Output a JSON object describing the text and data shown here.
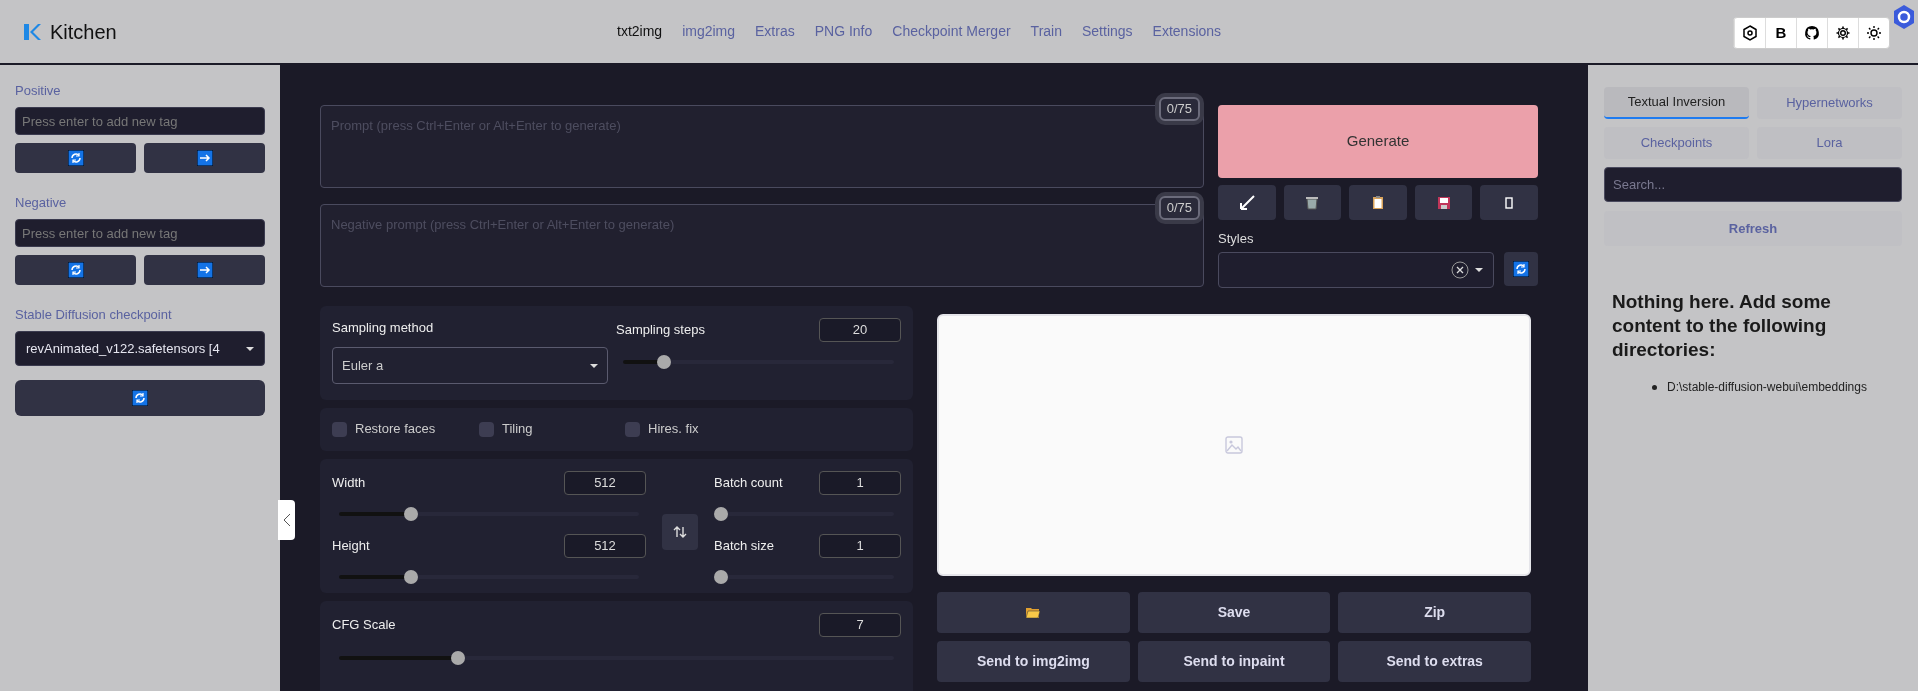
{
  "header": {
    "logo": "Kitchen",
    "nav": [
      {
        "label": "txt2img",
        "selected": true
      },
      {
        "label": "img2img",
        "selected": false
      },
      {
        "label": "Extras",
        "selected": false
      },
      {
        "label": "PNG Info",
        "selected": false
      },
      {
        "label": "Checkpoint Merger",
        "selected": false
      },
      {
        "label": "Train",
        "selected": false
      },
      {
        "label": "Settings",
        "selected": false
      },
      {
        "label": "Extensions",
        "selected": false
      }
    ],
    "buttons": [
      {
        "kind": "hex"
      },
      {
        "kind": "text",
        "label": "B"
      },
      {
        "kind": "github"
      },
      {
        "kind": "gear"
      },
      {
        "kind": "sun"
      }
    ]
  },
  "sidebar": {
    "sections": [
      {
        "label": "Positive",
        "placeholder": "Press enter to add new tag"
      },
      {
        "label": "Negative",
        "placeholder": "Press enter to add new tag"
      }
    ],
    "checkpoint": {
      "label": "Stable Diffusion checkpoint",
      "value": "revAnimated_v122.safetensors [4"
    }
  },
  "prompts": [
    {
      "placeholder": "Prompt (press Ctrl+Enter or Alt+Enter to generate)",
      "counter": "0/75"
    },
    {
      "placeholder": "Negative prompt (press Ctrl+Enter or Alt+Enter to generate)",
      "counter": "0/75"
    }
  ],
  "generate": {
    "label": "Generate",
    "tools": [
      {
        "kind": "check"
      },
      {
        "kind": "trash"
      },
      {
        "kind": "clipboard"
      },
      {
        "kind": "disk"
      },
      {
        "kind": "square"
      }
    ],
    "styles_label": "Styles"
  },
  "sampling": {
    "method_label": "Sampling method",
    "method": "Euler a",
    "steps": {
      "label": "Sampling steps",
      "value": "20",
      "level": 0.15
    }
  },
  "options": [
    {
      "label": "Restore faces",
      "checked": false
    },
    {
      "label": "Tiling",
      "checked": false
    },
    {
      "label": "Hires. fix",
      "checked": false
    }
  ],
  "size": [
    {
      "label": "Width",
      "value": "512",
      "level": 0.24
    },
    {
      "label": "Height",
      "value": "512",
      "level": 0.24
    }
  ],
  "batch": [
    {
      "label": "Batch count",
      "value": "1",
      "level": 0
    },
    {
      "label": "Batch size",
      "value": "1",
      "level": 0
    }
  ],
  "cfg": {
    "label": "CFG Scale",
    "value": "7",
    "level": 0.214
  },
  "gallery_buttons": [
    {
      "kind": "folder"
    },
    {
      "kind": "text",
      "label": "Save"
    },
    {
      "kind": "text",
      "label": "Zip"
    },
    {
      "kind": "text",
      "label": "Send to img2img"
    },
    {
      "kind": "text",
      "label": "Send to inpaint"
    },
    {
      "kind": "text",
      "label": "Send to extras"
    }
  ],
  "extra_networks": {
    "tabs": [
      {
        "label": "Textual Inversion",
        "selected": true
      },
      {
        "label": "Hypernetworks",
        "selected": false
      },
      {
        "label": "Checkpoints",
        "selected": false
      },
      {
        "label": "Lora",
        "selected": false
      }
    ],
    "search_placeholder": "Search...",
    "refresh": "Refresh",
    "message": "Nothing here. Add some content to the following directories:",
    "directories": [
      "D:\\stable-diffusion-webui\\embeddings"
    ]
  }
}
